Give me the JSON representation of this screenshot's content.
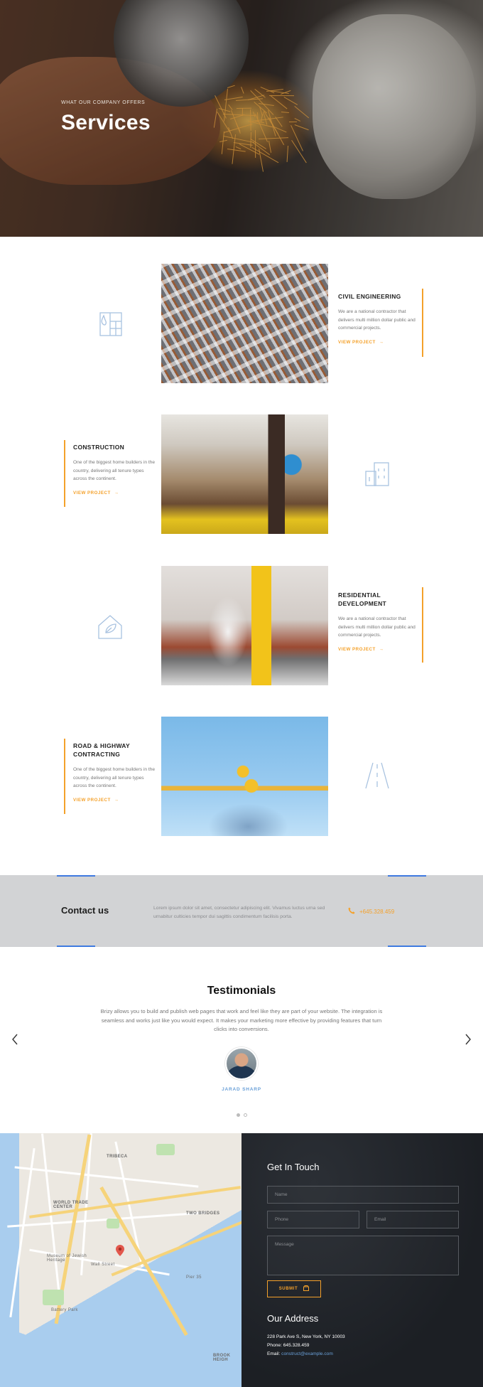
{
  "hero": {
    "eyebrow": "WHAT OUR COMPANY OFFERS",
    "title": "Services"
  },
  "services": [
    {
      "title": "CIVIL ENGINEERING",
      "description": "We are a national contractor that delivers multi million dollar public and commercial projects.",
      "link": "VIEW PROJECT",
      "icon": "floor-plan-icon"
    },
    {
      "title": "CONSTRUCTION",
      "description": "One of the biggest home builders in the country, delivering all tenure types across the continent.",
      "link": "VIEW PROJECT",
      "icon": "buildings-icon"
    },
    {
      "title": "RESIDENTIAL DEVELOPMENT",
      "description": "We are a national contractor that delivers multi million dollar public and commercial projects.",
      "link": "VIEW PROJECT",
      "icon": "leaf-house-icon"
    },
    {
      "title": "ROAD & HIGHWAY CONTRACTING",
      "description": "One of the biggest home builders in the country, delivering all tenure types across the continent.",
      "link": "VIEW PROJECT",
      "icon": "road-icon"
    }
  ],
  "contact": {
    "title": "Contact us",
    "text": "Lorem ipsum dolor sit amet, consectetur adipiscing elit. Vivamus luctus urna sed urnabitur culticies tempor dui sagittis condimentum facilisis porta.",
    "phone": "+645.328.459"
  },
  "testimonials": {
    "title": "Testimonials",
    "quote": "Brizy allows you to build and publish web pages that work and feel like they are part of your website. The integration is seamless and works just like you would expect. It makes your marketing more effective by providing features that turn clicks into conversions.",
    "name": "JARAD SHARP",
    "slide_index": 1,
    "slide_count": 2
  },
  "map": {
    "labels": [
      "TRIBECA",
      "WORLD TRADE CENTER",
      "TWO BRIDGES",
      "BROOK HEIGH",
      "Battery Park",
      "Wall Street",
      "Museum of Jewish Heritage",
      "Pier 35"
    ]
  },
  "touch": {
    "title": "Get In Touch",
    "name_placeholder": "Name",
    "phone_placeholder": "Phone",
    "email_placeholder": "Email",
    "message_placeholder": "Message",
    "submit": "SUBMIT",
    "address_title": "Our Address",
    "address": "228 Park Ave S, New York, NY 10003",
    "phone_label": "Phone:",
    "phone": "645.328.459",
    "email_label": "Email:",
    "email": "construct@example.com"
  },
  "colors": {
    "accent": "#f4a12b",
    "link_blue": "#6aa0d8",
    "icon_blue": "#a8c2e0",
    "dark_panel": "#1e2126"
  }
}
